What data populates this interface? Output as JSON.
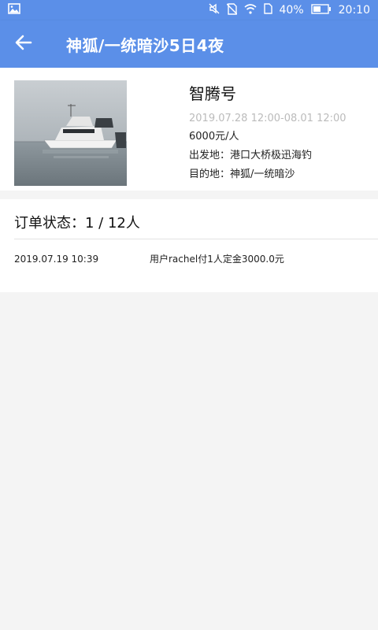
{
  "status_bar": {
    "battery_percent": "40%",
    "time": "20:10",
    "icons": [
      "image-icon",
      "mute-icon",
      "no-sim-icon",
      "wifi-icon",
      "sim-icon",
      "battery-icon"
    ]
  },
  "header": {
    "title": "神狐/一统暗沙5日4夜",
    "back_icon": "arrow-left-icon"
  },
  "trip": {
    "boat_name": "智腾号",
    "date_range": "2019.07.28 12:00-08.01 12:00",
    "price": "6000元/人",
    "departure": "出发地：港口大桥极迅海钓",
    "destination": "目的地：神狐/一统暗沙"
  },
  "order": {
    "status": "订单状态：1 / 12人",
    "records": [
      {
        "time": "2019.07.19 10:39",
        "description": "用户rachel付1人定金3000.0元"
      }
    ]
  },
  "colors": {
    "accent": "#5b8fe8",
    "muted_text": "#bbbbbb",
    "background": "#f4f4f4"
  }
}
